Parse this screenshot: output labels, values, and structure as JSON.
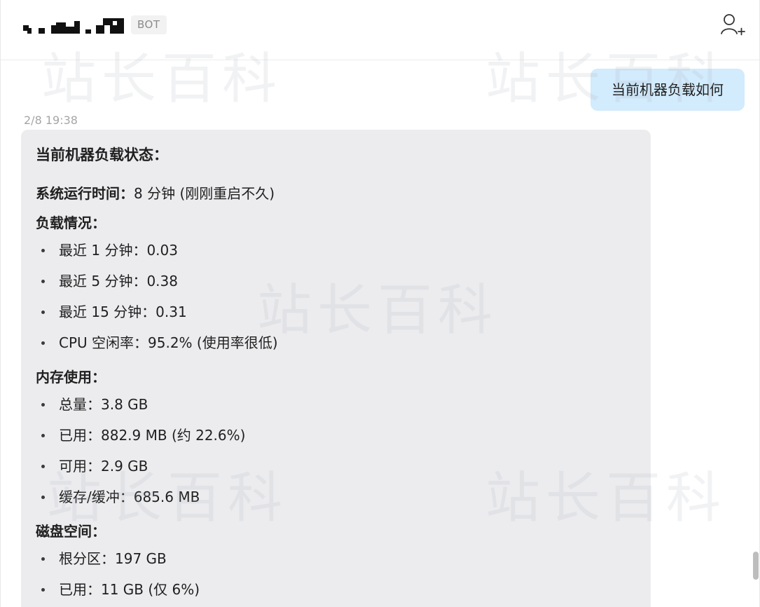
{
  "header": {
    "bot_badge": "BOT",
    "add_user_icon": "add-user-icon"
  },
  "chat": {
    "user_message": "当前机器负载如何",
    "timestamp": "2/8 19:38",
    "reply": {
      "title": "当前机器负载状态：",
      "uptime_label": "系统运行时间：",
      "uptime_value": "8 分钟 (刚刚重启不久)",
      "load": {
        "title": "负载情况：",
        "items": [
          "最近 1 分钟：0.03",
          "最近 5 分钟：0.38",
          "最近 15 分钟：0.31",
          "CPU 空闲率：95.2% (使用率很低)"
        ]
      },
      "memory": {
        "title": "内存使用：",
        "items": [
          "总量：3.8 GB",
          "已用：882.9 MB (约 22.6%)",
          "可用：2.9 GB",
          "缓存/缓冲：685.6 MB"
        ]
      },
      "disk": {
        "title": "磁盘空间：",
        "items": [
          "根分区：197 GB",
          "已用：11 GB (仅 6%)"
        ]
      }
    }
  },
  "watermark": "站长百科",
  "colors": {
    "user_bubble": "#d2ebfd",
    "bot_bubble": "#ececef",
    "badge_bg": "#f2f2f2"
  }
}
